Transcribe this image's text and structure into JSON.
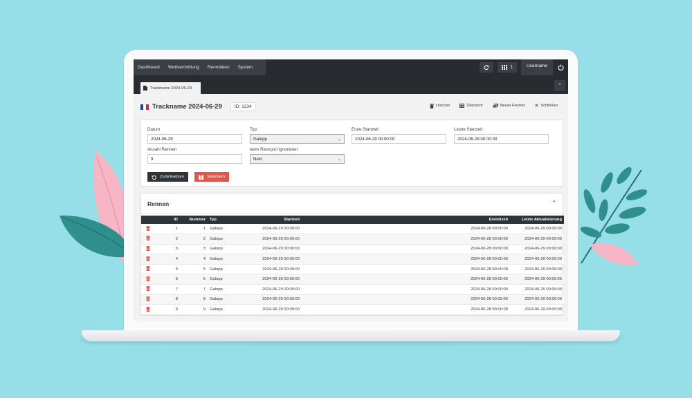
{
  "navbar": {
    "menu": [
      "Dashboard",
      "Wettvermittlung",
      "Renndaten",
      "System"
    ],
    "window_count": "1",
    "username": "Username"
  },
  "tab": {
    "label": "Trackname 2024-06-29"
  },
  "header": {
    "title": "Trackname 2024-06-29",
    "id_badge": "ID: 1234",
    "flag_colors": [
      "#1f3f9e",
      "#ffffff",
      "#e0232e"
    ],
    "actions": {
      "delete": "Löschen",
      "overview": "Übersicht",
      "new_window": "Neues Fenster",
      "close": "Schließen"
    }
  },
  "form": {
    "datum": {
      "label": "Datum",
      "value": "2024-06-29"
    },
    "typ": {
      "label": "Typ",
      "value": "Galopp"
    },
    "erste_startzeit": {
      "label": "Erste Startzeit",
      "value": "2024-06-29 00:00:00"
    },
    "letzte_startzeit": {
      "label": "Letzte Startzeit",
      "value": "2024-06-29 00:00:00"
    },
    "anzahl_rennen": {
      "label": "Anzahl Rennen",
      "value": "9"
    },
    "reimport": {
      "label": "beim Reimport ignorieren",
      "value": "Nein"
    },
    "reset_label": "Zurücksetzen",
    "save_label": "Speichern"
  },
  "rennen": {
    "title": "Rennen",
    "columns": [
      "ID",
      "Nummer",
      "Typ",
      "Startzeit",
      "Erstellzeit",
      "Letzte Aktualisierung"
    ],
    "rows": [
      {
        "id": "1",
        "nummer": "1",
        "typ": "Galopp",
        "startzeit": "2024-06-29 00:00:00",
        "erstellzeit": "2024-06-28 00:00:00",
        "aktualisierung": "2024-06-29 00:00:00"
      },
      {
        "id": "2",
        "nummer": "2",
        "typ": "Galopp",
        "startzeit": "2024-06-29 00:00:00",
        "erstellzeit": "2024-06-28 00:00:00",
        "aktualisierung": "2024-06-29 00:00:00"
      },
      {
        "id": "3",
        "nummer": "3",
        "typ": "Galopp",
        "startzeit": "2024-06-29 00:00:00",
        "erstellzeit": "2024-06-28 00:00:00",
        "aktualisierung": "2024-06-29 00:00:00"
      },
      {
        "id": "4",
        "nummer": "4",
        "typ": "Galopp",
        "startzeit": "2024-06-29 00:00:00",
        "erstellzeit": "2024-06-28 00:00:00",
        "aktualisierung": "2024-06-29 00:00:00"
      },
      {
        "id": "5",
        "nummer": "5",
        "typ": "Galopp",
        "startzeit": "2024-06-29 00:00:00",
        "erstellzeit": "2024-06-28 00:00:00",
        "aktualisierung": "2024-06-29 00:00:00"
      },
      {
        "id": "6",
        "nummer": "6",
        "typ": "Galopp",
        "startzeit": "2024-06-29 00:00:00",
        "erstellzeit": "2024-06-28 00:00:00",
        "aktualisierung": "2024-06-29 00:00:00"
      },
      {
        "id": "7",
        "nummer": "7",
        "typ": "Galopp",
        "startzeit": "2024-06-29 00:00:00",
        "erstellzeit": "2024-06-28 00:00:00",
        "aktualisierung": "2024-06-29 00:00:00"
      },
      {
        "id": "8",
        "nummer": "8",
        "typ": "Galopp",
        "startzeit": "2024-06-29 00:00:00",
        "erstellzeit": "2024-06-28 00:00:00",
        "aktualisierung": "2024-06-29 00:00:00"
      },
      {
        "id": "9",
        "nummer": "9",
        "typ": "Galopp",
        "startzeit": "2024-06-29 00:00:00",
        "erstellzeit": "2024-06-28 00:00:00",
        "aktualisierung": "2024-06-29 00:00:00"
      }
    ]
  },
  "colors": {
    "background": "#97dfe8",
    "navbar": "#282c30",
    "accent_red": "#e2574c",
    "leaf_pink": "#f6b6c6",
    "leaf_teal": "#2f8f8c"
  }
}
